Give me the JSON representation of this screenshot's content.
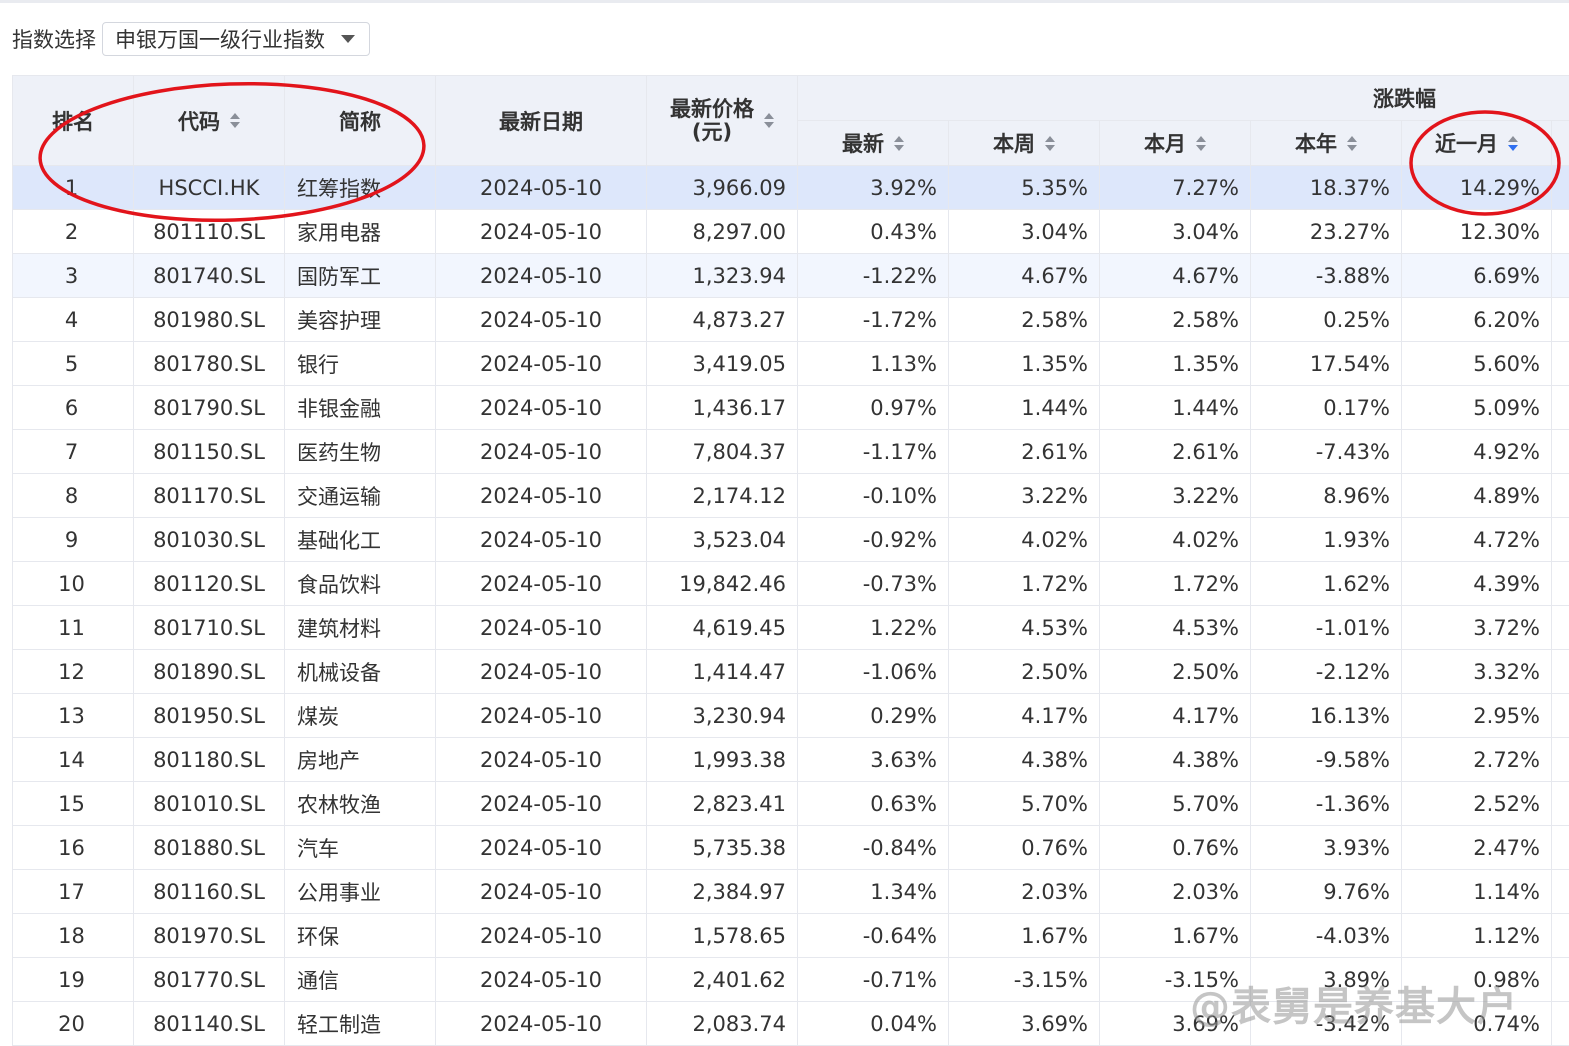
{
  "selector": {
    "label": "指数选择",
    "value": "申银万国一级行业指数"
  },
  "headers": {
    "rank": "排名",
    "code": "代码",
    "name": "简称",
    "date": "最新日期",
    "price_line1": "最新价格",
    "price_line2": "(元)",
    "group": "涨跌幅",
    "latest": "最新",
    "week": "本周",
    "month": "本月",
    "year": "本年",
    "last_month": "近一月"
  },
  "colors": {
    "up": "#e8312b",
    "down": "#1b9a3c",
    "highlight_row": "#dde7fb",
    "annotation": "#e2141b",
    "sort_active": "#2f6ff0"
  },
  "rows": [
    {
      "rank": "1",
      "code": "HSCCI.HK",
      "name": "红筹指数",
      "date": "2024-05-10",
      "price": "3,966.09",
      "latest": "3.92%",
      "week": "5.35%",
      "month": "7.27%",
      "year": "18.37%",
      "m1": "14.29%"
    },
    {
      "rank": "2",
      "code": "801110.SL",
      "name": "家用电器",
      "date": "2024-05-10",
      "price": "8,297.00",
      "latest": "0.43%",
      "week": "3.04%",
      "month": "3.04%",
      "year": "23.27%",
      "m1": "12.30%"
    },
    {
      "rank": "3",
      "code": "801740.SL",
      "name": "国防军工",
      "date": "2024-05-10",
      "price": "1,323.94",
      "latest": "-1.22%",
      "week": "4.67%",
      "month": "4.67%",
      "year": "-3.88%",
      "m1": "6.69%"
    },
    {
      "rank": "4",
      "code": "801980.SL",
      "name": "美容护理",
      "date": "2024-05-10",
      "price": "4,873.27",
      "latest": "-1.72%",
      "week": "2.58%",
      "month": "2.58%",
      "year": "0.25%",
      "m1": "6.20%"
    },
    {
      "rank": "5",
      "code": "801780.SL",
      "name": "银行",
      "date": "2024-05-10",
      "price": "3,419.05",
      "latest": "1.13%",
      "week": "1.35%",
      "month": "1.35%",
      "year": "17.54%",
      "m1": "5.60%"
    },
    {
      "rank": "6",
      "code": "801790.SL",
      "name": "非银金融",
      "date": "2024-05-10",
      "price": "1,436.17",
      "latest": "0.97%",
      "week": "1.44%",
      "month": "1.44%",
      "year": "0.17%",
      "m1": "5.09%"
    },
    {
      "rank": "7",
      "code": "801150.SL",
      "name": "医药生物",
      "date": "2024-05-10",
      "price": "7,804.37",
      "latest": "-1.17%",
      "week": "2.61%",
      "month": "2.61%",
      "year": "-7.43%",
      "m1": "4.92%"
    },
    {
      "rank": "8",
      "code": "801170.SL",
      "name": "交通运输",
      "date": "2024-05-10",
      "price": "2,174.12",
      "latest": "-0.10%",
      "week": "3.22%",
      "month": "3.22%",
      "year": "8.96%",
      "m1": "4.89%"
    },
    {
      "rank": "9",
      "code": "801030.SL",
      "name": "基础化工",
      "date": "2024-05-10",
      "price": "3,523.04",
      "latest": "-0.92%",
      "week": "4.02%",
      "month": "4.02%",
      "year": "1.93%",
      "m1": "4.72%"
    },
    {
      "rank": "10",
      "code": "801120.SL",
      "name": "食品饮料",
      "date": "2024-05-10",
      "price": "19,842.46",
      "latest": "-0.73%",
      "week": "1.72%",
      "month": "1.72%",
      "year": "1.62%",
      "m1": "4.39%"
    },
    {
      "rank": "11",
      "code": "801710.SL",
      "name": "建筑材料",
      "date": "2024-05-10",
      "price": "4,619.45",
      "latest": "1.22%",
      "week": "4.53%",
      "month": "4.53%",
      "year": "-1.01%",
      "m1": "3.72%"
    },
    {
      "rank": "12",
      "code": "801890.SL",
      "name": "机械设备",
      "date": "2024-05-10",
      "price": "1,414.47",
      "latest": "-1.06%",
      "week": "2.50%",
      "month": "2.50%",
      "year": "-2.12%",
      "m1": "3.32%"
    },
    {
      "rank": "13",
      "code": "801950.SL",
      "name": "煤炭",
      "date": "2024-05-10",
      "price": "3,230.94",
      "latest": "0.29%",
      "week": "4.17%",
      "month": "4.17%",
      "year": "16.13%",
      "m1": "2.95%"
    },
    {
      "rank": "14",
      "code": "801180.SL",
      "name": "房地产",
      "date": "2024-05-10",
      "price": "1,993.38",
      "latest": "3.63%",
      "week": "4.38%",
      "month": "4.38%",
      "year": "-9.58%",
      "m1": "2.72%"
    },
    {
      "rank": "15",
      "code": "801010.SL",
      "name": "农林牧渔",
      "date": "2024-05-10",
      "price": "2,823.41",
      "latest": "0.63%",
      "week": "5.70%",
      "month": "5.70%",
      "year": "-1.36%",
      "m1": "2.52%"
    },
    {
      "rank": "16",
      "code": "801880.SL",
      "name": "汽车",
      "date": "2024-05-10",
      "price": "5,735.38",
      "latest": "-0.84%",
      "week": "0.76%",
      "month": "0.76%",
      "year": "3.93%",
      "m1": "2.47%"
    },
    {
      "rank": "17",
      "code": "801160.SL",
      "name": "公用事业",
      "date": "2024-05-10",
      "price": "2,384.97",
      "latest": "1.34%",
      "week": "2.03%",
      "month": "2.03%",
      "year": "9.76%",
      "m1": "1.14%"
    },
    {
      "rank": "18",
      "code": "801970.SL",
      "name": "环保",
      "date": "2024-05-10",
      "price": "1,578.65",
      "latest": "-0.64%",
      "week": "1.67%",
      "month": "1.67%",
      "year": "-4.03%",
      "m1": "1.12%"
    },
    {
      "rank": "19",
      "code": "801770.SL",
      "name": "通信",
      "date": "2024-05-10",
      "price": "2,401.62",
      "latest": "-0.71%",
      "week": "-3.15%",
      "month": "-3.15%",
      "year": "3.89%",
      "m1": "0.98%"
    },
    {
      "rank": "20",
      "code": "801140.SL",
      "name": "轻工制造",
      "date": "2024-05-10",
      "price": "2,083.74",
      "latest": "0.04%",
      "week": "3.69%",
      "month": "3.69%",
      "year": "-3.42%",
      "m1": "0.74%"
    }
  ],
  "watermark": "@表舅是养基大户"
}
